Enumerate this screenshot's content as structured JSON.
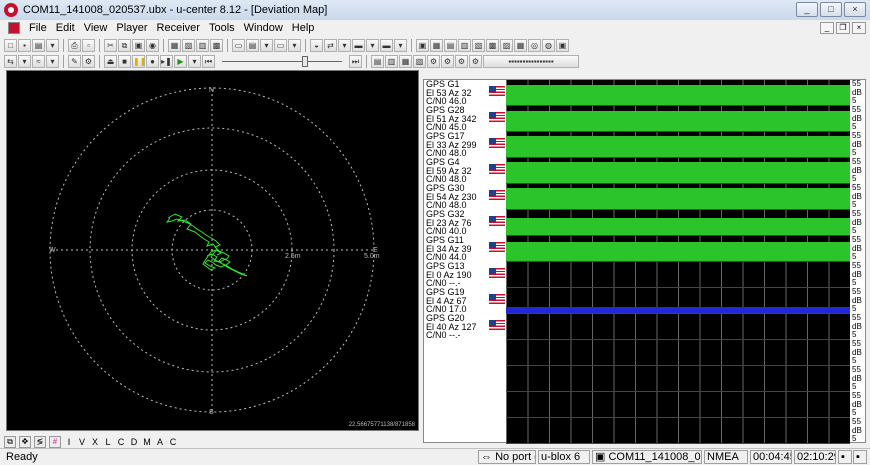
{
  "window": {
    "title": "COM11_141008_020537.ubx - u-center 8.12 - [Deviation Map]",
    "controls": [
      "_",
      "□",
      "×"
    ]
  },
  "menubar": {
    "items": [
      "File",
      "Edit",
      "View",
      "Player",
      "Receiver",
      "Tools",
      "Window",
      "Help"
    ]
  },
  "map": {
    "labels": {
      "north": "N",
      "south": "S",
      "east": "E",
      "west": "W",
      "ring_mid": "2.5m",
      "ring_outer": "5.0m"
    },
    "footer": "22.56675771138/871858",
    "track_color": "#2ee82e"
  },
  "satellites": [
    {
      "name": "GPS G1",
      "el_az": "El 53 Az 32",
      "cn0": "C/N0 46.0",
      "level": 0.9,
      "color": "#2bc52b"
    },
    {
      "name": "GPS G28",
      "el_az": "El 51 Az 342",
      "cn0": "C/N0 45.0",
      "level": 0.9,
      "color": "#2bc52b"
    },
    {
      "name": "GPS G17",
      "el_az": "El 33 Az 299",
      "cn0": "C/N0 48.0",
      "level": 0.95,
      "color": "#2bc52b"
    },
    {
      "name": "GPS G4",
      "el_az": "El 59 Az 32",
      "cn0": "C/N0 48.0",
      "level": 0.95,
      "color": "#2bc52b"
    },
    {
      "name": "GPS G30",
      "el_az": "El 54 Az 230",
      "cn0": "C/N0 48.0",
      "level": 0.95,
      "color": "#2bc52b"
    },
    {
      "name": "GPS G32",
      "el_az": "El 23 Az 76",
      "cn0": "C/N0 40.0",
      "level": 0.75,
      "color": "#2bc52b"
    },
    {
      "name": "GPS G11",
      "el_az": "El 34 Az 39",
      "cn0": "C/N0 44.0",
      "level": 0.85,
      "color": "#2bc52b"
    },
    {
      "name": "GPS G13",
      "el_az": "El 0 Az 190",
      "cn0": "C/N0 --.-",
      "level": 0,
      "color": "#2bc52b"
    },
    {
      "name": "GPS G19",
      "el_az": "El 4 Az 67",
      "cn0": "C/N0 17.0",
      "level": 0.25,
      "color": "#1f2ad6"
    },
    {
      "name": "GPS G20",
      "el_az": "El 40 Az 127",
      "cn0": "C/N0 --.-",
      "level": 0,
      "color": "#2bc52b"
    }
  ],
  "scale": {
    "top": "55",
    "unit": "dB",
    "bottom": "5"
  },
  "bottom_toolbar": [
    "I",
    "V",
    "X",
    "L",
    "C",
    "D",
    "M",
    "A",
    "C"
  ],
  "statusbar": {
    "ready": "Ready",
    "port": "No port op",
    "receiver": "u-blox 6",
    "file": "COM11_141008_0205:",
    "protocol": "NMEA",
    "elapsed": "00:04:45",
    "time": "02:10:29"
  }
}
